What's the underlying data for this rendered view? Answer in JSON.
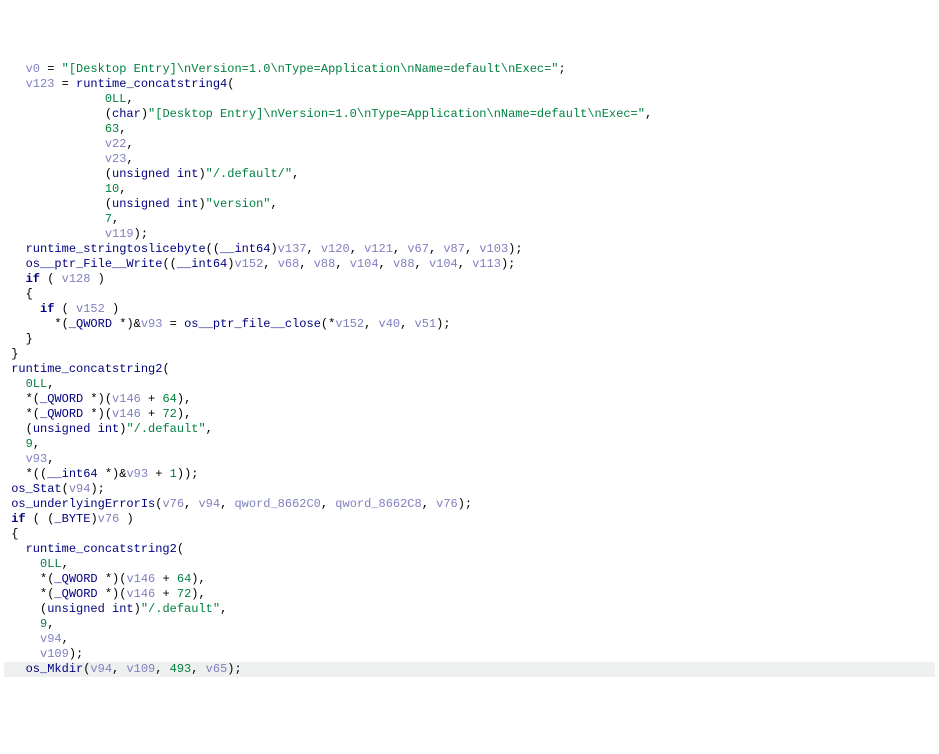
{
  "lines": [
    {
      "indent": "   ",
      "tokens": [
        {
          "t": "v0",
          "c": "var"
        },
        {
          "t": " = ",
          "c": ""
        },
        {
          "t": "\"[Desktop Entry]\\nVersion=1.0\\nType=Application\\nName=default\\nExec=\"",
          "c": "str"
        },
        {
          "t": ";",
          "c": ""
        }
      ]
    },
    {
      "indent": "   ",
      "tokens": [
        {
          "t": "v123",
          "c": "var"
        },
        {
          "t": " = ",
          "c": ""
        },
        {
          "t": "runtime_concatstring4",
          "c": "fn"
        },
        {
          "t": "(",
          "c": ""
        }
      ]
    },
    {
      "indent": "              ",
      "tokens": [
        {
          "t": "0LL",
          "c": "num"
        },
        {
          "t": ",",
          "c": ""
        }
      ]
    },
    {
      "indent": "              ",
      "tokens": [
        {
          "t": "(",
          "c": ""
        },
        {
          "t": "char",
          "c": "type"
        },
        {
          "t": ")",
          "c": ""
        },
        {
          "t": "\"[Desktop Entry]\\nVersion=1.0\\nType=Application\\nName=default\\nExec=\"",
          "c": "str"
        },
        {
          "t": ",",
          "c": ""
        }
      ]
    },
    {
      "indent": "              ",
      "tokens": [
        {
          "t": "63",
          "c": "num"
        },
        {
          "t": ",",
          "c": ""
        }
      ]
    },
    {
      "indent": "              ",
      "tokens": [
        {
          "t": "v22",
          "c": "var"
        },
        {
          "t": ",",
          "c": ""
        }
      ]
    },
    {
      "indent": "              ",
      "tokens": [
        {
          "t": "v23",
          "c": "var"
        },
        {
          "t": ",",
          "c": ""
        }
      ]
    },
    {
      "indent": "              ",
      "tokens": [
        {
          "t": "(",
          "c": ""
        },
        {
          "t": "unsigned int",
          "c": "type"
        },
        {
          "t": ")",
          "c": ""
        },
        {
          "t": "\"/.default/\"",
          "c": "str"
        },
        {
          "t": ",",
          "c": ""
        }
      ]
    },
    {
      "indent": "              ",
      "tokens": [
        {
          "t": "10",
          "c": "num"
        },
        {
          "t": ",",
          "c": ""
        }
      ]
    },
    {
      "indent": "              ",
      "tokens": [
        {
          "t": "(",
          "c": ""
        },
        {
          "t": "unsigned int",
          "c": "type"
        },
        {
          "t": ")",
          "c": ""
        },
        {
          "t": "\"version\"",
          "c": "str"
        },
        {
          "t": ",",
          "c": ""
        }
      ]
    },
    {
      "indent": "              ",
      "tokens": [
        {
          "t": "7",
          "c": "num"
        },
        {
          "t": ",",
          "c": ""
        }
      ]
    },
    {
      "indent": "              ",
      "tokens": [
        {
          "t": "v119",
          "c": "var"
        },
        {
          "t": ");",
          "c": ""
        }
      ]
    },
    {
      "indent": "   ",
      "tokens": [
        {
          "t": "runtime_stringtoslicebyte",
          "c": "fn"
        },
        {
          "t": "((",
          "c": ""
        },
        {
          "t": "__int64",
          "c": "type"
        },
        {
          "t": ")",
          "c": ""
        },
        {
          "t": "v137",
          "c": "var"
        },
        {
          "t": ", ",
          "c": ""
        },
        {
          "t": "v120",
          "c": "var"
        },
        {
          "t": ", ",
          "c": ""
        },
        {
          "t": "v121",
          "c": "var"
        },
        {
          "t": ", ",
          "c": ""
        },
        {
          "t": "v67",
          "c": "var"
        },
        {
          "t": ", ",
          "c": ""
        },
        {
          "t": "v87",
          "c": "var"
        },
        {
          "t": ", ",
          "c": ""
        },
        {
          "t": "v103",
          "c": "var"
        },
        {
          "t": ");",
          "c": ""
        }
      ]
    },
    {
      "indent": "   ",
      "tokens": [
        {
          "t": "os__ptr_File__Write",
          "c": "fn"
        },
        {
          "t": "((",
          "c": ""
        },
        {
          "t": "__int64",
          "c": "type"
        },
        {
          "t": ")",
          "c": ""
        },
        {
          "t": "v152",
          "c": "var"
        },
        {
          "t": ", ",
          "c": ""
        },
        {
          "t": "v68",
          "c": "var"
        },
        {
          "t": ", ",
          "c": ""
        },
        {
          "t": "v88",
          "c": "var"
        },
        {
          "t": ", ",
          "c": ""
        },
        {
          "t": "v104",
          "c": "var"
        },
        {
          "t": ", ",
          "c": ""
        },
        {
          "t": "v88",
          "c": "var"
        },
        {
          "t": ", ",
          "c": ""
        },
        {
          "t": "v104",
          "c": "var"
        },
        {
          "t": ", ",
          "c": ""
        },
        {
          "t": "v113",
          "c": "var"
        },
        {
          "t": ");",
          "c": ""
        }
      ]
    },
    {
      "indent": "   ",
      "tokens": [
        {
          "t": "if",
          "c": "kw"
        },
        {
          "t": " ( ",
          "c": ""
        },
        {
          "t": "v128",
          "c": "var"
        },
        {
          "t": " )",
          "c": ""
        }
      ]
    },
    {
      "indent": "   ",
      "tokens": [
        {
          "t": "{",
          "c": ""
        }
      ]
    },
    {
      "indent": "     ",
      "tokens": [
        {
          "t": "if",
          "c": "kw"
        },
        {
          "t": " ( ",
          "c": ""
        },
        {
          "t": "v152",
          "c": "var"
        },
        {
          "t": " )",
          "c": ""
        }
      ]
    },
    {
      "indent": "       ",
      "tokens": [
        {
          "t": "*(",
          "c": ""
        },
        {
          "t": "_QWORD",
          "c": "type"
        },
        {
          "t": " *)&",
          "c": ""
        },
        {
          "t": "v93",
          "c": "var"
        },
        {
          "t": " = ",
          "c": ""
        },
        {
          "t": "os__ptr_file__close",
          "c": "fn"
        },
        {
          "t": "(*",
          "c": ""
        },
        {
          "t": "v152",
          "c": "var"
        },
        {
          "t": ", ",
          "c": ""
        },
        {
          "t": "v40",
          "c": "var"
        },
        {
          "t": ", ",
          "c": ""
        },
        {
          "t": "v51",
          "c": "var"
        },
        {
          "t": ");",
          "c": ""
        }
      ]
    },
    {
      "indent": "   ",
      "tokens": [
        {
          "t": "}",
          "c": ""
        }
      ]
    },
    {
      "indent": " ",
      "tokens": [
        {
          "t": "}",
          "c": ""
        }
      ]
    },
    {
      "indent": " ",
      "tokens": [
        {
          "t": "runtime_concatstring2",
          "c": "fn"
        },
        {
          "t": "(",
          "c": ""
        }
      ]
    },
    {
      "indent": "   ",
      "tokens": [
        {
          "t": "0LL",
          "c": "num"
        },
        {
          "t": ",",
          "c": ""
        }
      ]
    },
    {
      "indent": "   ",
      "tokens": [
        {
          "t": "*(",
          "c": ""
        },
        {
          "t": "_QWORD",
          "c": "type"
        },
        {
          "t": " *)(",
          "c": ""
        },
        {
          "t": "v146",
          "c": "var"
        },
        {
          "t": " + ",
          "c": ""
        },
        {
          "t": "64",
          "c": "num"
        },
        {
          "t": "),",
          "c": ""
        }
      ]
    },
    {
      "indent": "   ",
      "tokens": [
        {
          "t": "*(",
          "c": ""
        },
        {
          "t": "_QWORD",
          "c": "type"
        },
        {
          "t": " *)(",
          "c": ""
        },
        {
          "t": "v146",
          "c": "var"
        },
        {
          "t": " + ",
          "c": ""
        },
        {
          "t": "72",
          "c": "num"
        },
        {
          "t": "),",
          "c": ""
        }
      ]
    },
    {
      "indent": "   ",
      "tokens": [
        {
          "t": "(",
          "c": ""
        },
        {
          "t": "unsigned int",
          "c": "type"
        },
        {
          "t": ")",
          "c": ""
        },
        {
          "t": "\"/.default\"",
          "c": "str"
        },
        {
          "t": ",",
          "c": ""
        }
      ]
    },
    {
      "indent": "   ",
      "tokens": [
        {
          "t": "9",
          "c": "num"
        },
        {
          "t": ",",
          "c": ""
        }
      ]
    },
    {
      "indent": "   ",
      "tokens": [
        {
          "t": "v93",
          "c": "var"
        },
        {
          "t": ",",
          "c": ""
        }
      ]
    },
    {
      "indent": "   ",
      "tokens": [
        {
          "t": "*((",
          "c": ""
        },
        {
          "t": "__int64",
          "c": "type"
        },
        {
          "t": " *)&",
          "c": ""
        },
        {
          "t": "v93",
          "c": "var"
        },
        {
          "t": " + ",
          "c": ""
        },
        {
          "t": "1",
          "c": "num"
        },
        {
          "t": "));",
          "c": ""
        }
      ]
    },
    {
      "indent": " ",
      "tokens": [
        {
          "t": "os_Stat",
          "c": "fn"
        },
        {
          "t": "(",
          "c": ""
        },
        {
          "t": "v94",
          "c": "var"
        },
        {
          "t": ");",
          "c": ""
        }
      ]
    },
    {
      "indent": " ",
      "tokens": [
        {
          "t": "os_underlyingErrorIs",
          "c": "fn"
        },
        {
          "t": "(",
          "c": ""
        },
        {
          "t": "v76",
          "c": "var"
        },
        {
          "t": ", ",
          "c": ""
        },
        {
          "t": "v94",
          "c": "var"
        },
        {
          "t": ", ",
          "c": ""
        },
        {
          "t": "qword_8662C0",
          "c": "var"
        },
        {
          "t": ", ",
          "c": ""
        },
        {
          "t": "qword_8662C8",
          "c": "var"
        },
        {
          "t": ", ",
          "c": ""
        },
        {
          "t": "v76",
          "c": "var"
        },
        {
          "t": ");",
          "c": ""
        }
      ]
    },
    {
      "indent": " ",
      "tokens": [
        {
          "t": "if",
          "c": "kw"
        },
        {
          "t": " ( (",
          "c": ""
        },
        {
          "t": "_BYTE",
          "c": "type"
        },
        {
          "t": ")",
          "c": ""
        },
        {
          "t": "v76",
          "c": "var"
        },
        {
          "t": " )",
          "c": ""
        }
      ]
    },
    {
      "indent": " ",
      "tokens": [
        {
          "t": "{",
          "c": ""
        }
      ]
    },
    {
      "indent": "   ",
      "tokens": [
        {
          "t": "runtime_concatstring2",
          "c": "fn"
        },
        {
          "t": "(",
          "c": ""
        }
      ]
    },
    {
      "indent": "     ",
      "tokens": [
        {
          "t": "0LL",
          "c": "num"
        },
        {
          "t": ",",
          "c": ""
        }
      ]
    },
    {
      "indent": "     ",
      "tokens": [
        {
          "t": "*(",
          "c": ""
        },
        {
          "t": "_QWORD",
          "c": "type"
        },
        {
          "t": " *)(",
          "c": ""
        },
        {
          "t": "v146",
          "c": "var"
        },
        {
          "t": " + ",
          "c": ""
        },
        {
          "t": "64",
          "c": "num"
        },
        {
          "t": "),",
          "c": ""
        }
      ]
    },
    {
      "indent": "     ",
      "tokens": [
        {
          "t": "*(",
          "c": ""
        },
        {
          "t": "_QWORD",
          "c": "type"
        },
        {
          "t": " *)(",
          "c": ""
        },
        {
          "t": "v146",
          "c": "var"
        },
        {
          "t": " + ",
          "c": ""
        },
        {
          "t": "72",
          "c": "num"
        },
        {
          "t": "),",
          "c": ""
        }
      ]
    },
    {
      "indent": "     ",
      "tokens": [
        {
          "t": "(",
          "c": ""
        },
        {
          "t": "unsigned int",
          "c": "type"
        },
        {
          "t": ")",
          "c": ""
        },
        {
          "t": "\"/.default\"",
          "c": "str"
        },
        {
          "t": ",",
          "c": ""
        }
      ]
    },
    {
      "indent": "     ",
      "tokens": [
        {
          "t": "9",
          "c": "num"
        },
        {
          "t": ",",
          "c": ""
        }
      ]
    },
    {
      "indent": "     ",
      "tokens": [
        {
          "t": "v94",
          "c": "var"
        },
        {
          "t": ",",
          "c": ""
        }
      ]
    },
    {
      "indent": "     ",
      "tokens": [
        {
          "t": "v109",
          "c": "var"
        },
        {
          "t": ");",
          "c": ""
        }
      ]
    },
    {
      "indent": "   ",
      "tokens": [
        {
          "t": "os_Mkdir",
          "c": "fn"
        },
        {
          "t": "(",
          "c": ""
        },
        {
          "t": "v94",
          "c": "var"
        },
        {
          "t": ", ",
          "c": ""
        },
        {
          "t": "v109",
          "c": "var"
        },
        {
          "t": ", ",
          "c": ""
        },
        {
          "t": "493",
          "c": "num"
        },
        {
          "t": ", ",
          "c": ""
        },
        {
          "t": "v65",
          "c": "var"
        },
        {
          "t": ");",
          "c": ""
        }
      ],
      "hl": true
    }
  ]
}
